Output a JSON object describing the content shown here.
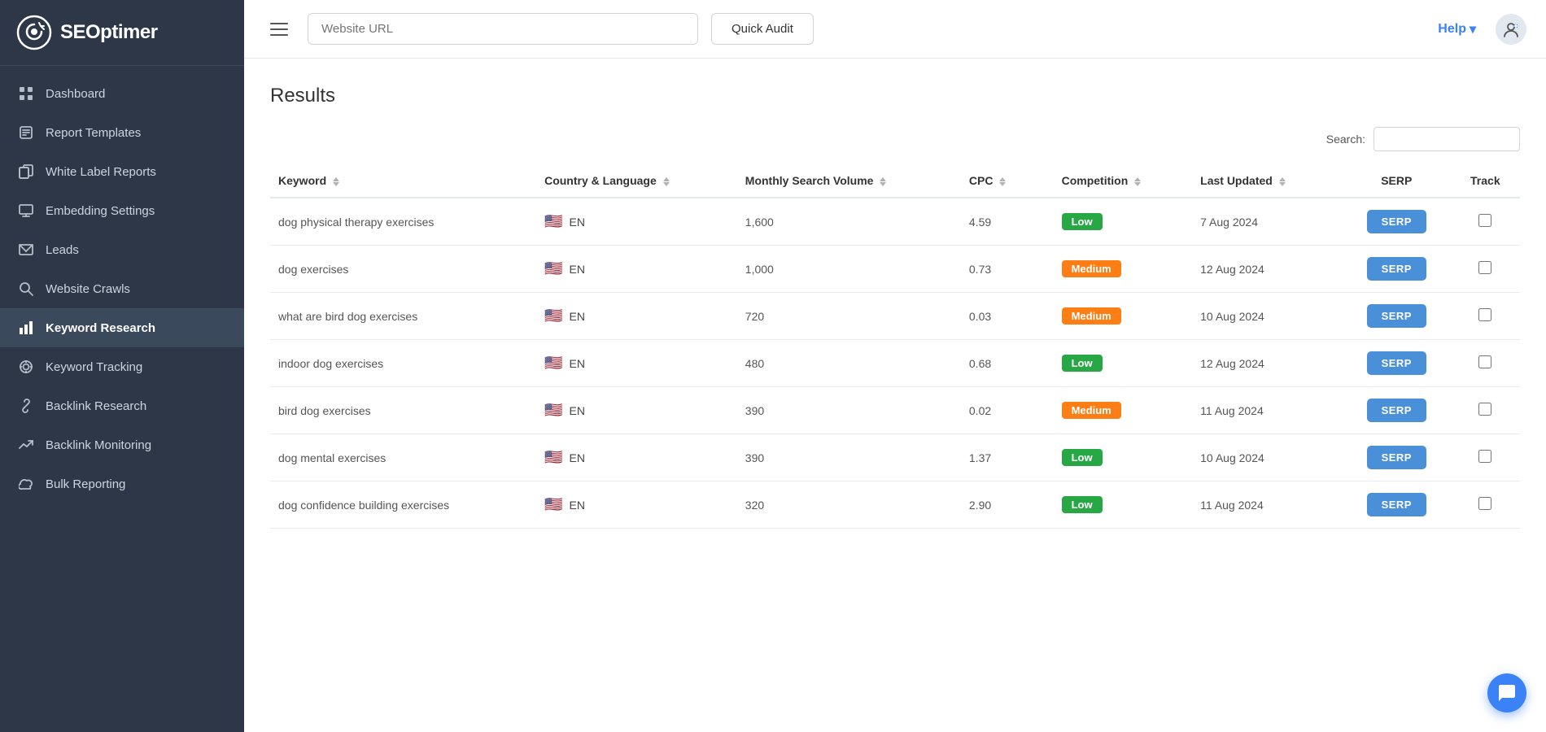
{
  "logo": {
    "text": "SEOptimer"
  },
  "header": {
    "url_placeholder": "Website URL",
    "quick_audit_label": "Quick Audit",
    "help_label": "Help",
    "help_arrow": "▾"
  },
  "sidebar": {
    "items": [
      {
        "id": "dashboard",
        "label": "Dashboard",
        "icon": "grid"
      },
      {
        "id": "report-templates",
        "label": "Report Templates",
        "icon": "edit"
      },
      {
        "id": "white-label",
        "label": "White Label Reports",
        "icon": "copy"
      },
      {
        "id": "embedding",
        "label": "Embedding Settings",
        "icon": "monitor"
      },
      {
        "id": "leads",
        "label": "Leads",
        "icon": "mail"
      },
      {
        "id": "website-crawls",
        "label": "Website Crawls",
        "icon": "search"
      },
      {
        "id": "keyword-research",
        "label": "Keyword Research",
        "icon": "bar-chart",
        "active": true
      },
      {
        "id": "keyword-tracking",
        "label": "Keyword Tracking",
        "icon": "target"
      },
      {
        "id": "backlink-research",
        "label": "Backlink Research",
        "icon": "link"
      },
      {
        "id": "backlink-monitoring",
        "label": "Backlink Monitoring",
        "icon": "trending-up"
      },
      {
        "id": "bulk-reporting",
        "label": "Bulk Reporting",
        "icon": "cloud"
      }
    ]
  },
  "search": {
    "label": "Search:",
    "placeholder": ""
  },
  "results": {
    "title": "Results",
    "columns": {
      "keyword": "Keyword",
      "country_language": "Country & Language",
      "monthly_search_volume": "Monthly Search Volume",
      "cpc": "CPC",
      "competition": "Competition",
      "last_updated": "Last Updated",
      "serp": "SERP",
      "track": "Track"
    },
    "rows": [
      {
        "keyword": "dog physical therapy exercises",
        "flag": "🇺🇸",
        "language": "EN",
        "volume": "1,600",
        "cpc": "4.59",
        "competition": "Low",
        "competition_type": "low",
        "last_updated": "7 Aug 2024"
      },
      {
        "keyword": "dog exercises",
        "flag": "🇺🇸",
        "language": "EN",
        "volume": "1,000",
        "cpc": "0.73",
        "competition": "Medium",
        "competition_type": "medium",
        "last_updated": "12 Aug 2024"
      },
      {
        "keyword": "what are bird dog exercises",
        "flag": "🇺🇸",
        "language": "EN",
        "volume": "720",
        "cpc": "0.03",
        "competition": "Medium",
        "competition_type": "medium",
        "last_updated": "10 Aug 2024"
      },
      {
        "keyword": "indoor dog exercises",
        "flag": "🇺🇸",
        "language": "EN",
        "volume": "480",
        "cpc": "0.68",
        "competition": "Low",
        "competition_type": "low",
        "last_updated": "12 Aug 2024"
      },
      {
        "keyword": "bird dog exercises",
        "flag": "🇺🇸",
        "language": "EN",
        "volume": "390",
        "cpc": "0.02",
        "competition": "Medium",
        "competition_type": "medium",
        "last_updated": "11 Aug 2024"
      },
      {
        "keyword": "dog mental exercises",
        "flag": "🇺🇸",
        "language": "EN",
        "volume": "390",
        "cpc": "1.37",
        "competition": "Low",
        "competition_type": "low",
        "last_updated": "10 Aug 2024"
      },
      {
        "keyword": "dog confidence building exercises",
        "flag": "🇺🇸",
        "language": "EN",
        "volume": "320",
        "cpc": "2.90",
        "competition": "Low",
        "competition_type": "low",
        "last_updated": "11 Aug 2024"
      }
    ],
    "serp_label": "SERP"
  }
}
